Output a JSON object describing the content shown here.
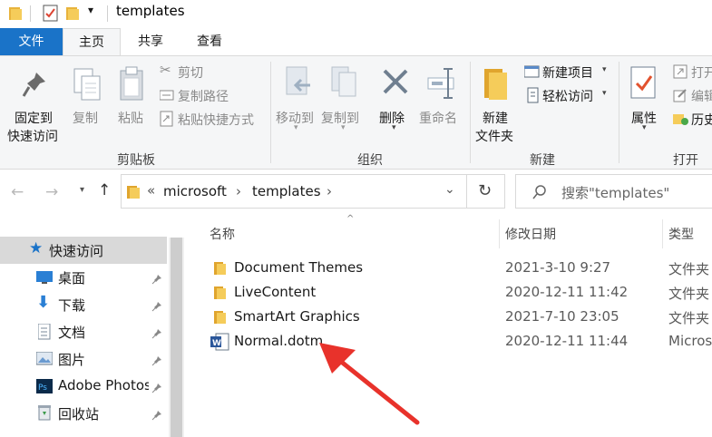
{
  "window": {
    "title": "templates"
  },
  "menu": {
    "file": "文件",
    "home": "主页",
    "share": "共享",
    "view": "查看"
  },
  "ribbon": {
    "pin_quick_access": [
      "固定到",
      "快速访问"
    ],
    "copy": "复制",
    "paste": "粘贴",
    "cut": "剪切",
    "copy_path": "复制路径",
    "paste_shortcut": "粘贴快捷方式",
    "move_to": "移动到",
    "copy_to": "复制到",
    "delete": "删除",
    "rename": "重命名",
    "new_folder": [
      "新建",
      "文件夹"
    ],
    "new_item": "新建项目",
    "easy_access": "轻松访问",
    "properties": "属性",
    "open": "打开",
    "edit": "编辑",
    "history": "历史",
    "groups": {
      "clipboard": "剪贴板",
      "organize": "组织",
      "new": "新建",
      "open": "打开"
    }
  },
  "address": {
    "overflow": "«",
    "crumbs": [
      "microsoft",
      "templates"
    ],
    "search_placeholder": "搜索\"templates\""
  },
  "sidebar": {
    "items": [
      {
        "label": "快速访问",
        "icon": "star-icon",
        "pinned": false
      },
      {
        "label": "桌面",
        "icon": "desktop-icon",
        "pinned": true
      },
      {
        "label": "下载",
        "icon": "download-icon",
        "pinned": true
      },
      {
        "label": "文档",
        "icon": "document-icon",
        "pinned": true
      },
      {
        "label": "图片",
        "icon": "pictures-icon",
        "pinned": true
      },
      {
        "label": "Adobe Photoshop",
        "icon": "photoshop-icon",
        "pinned": true
      },
      {
        "label": "回收站",
        "icon": "recycle-bin-icon",
        "pinned": true
      }
    ]
  },
  "columns": {
    "name": "名称",
    "date": "修改日期",
    "type": "类型"
  },
  "files": [
    {
      "name": "Document Themes",
      "date": "2021-3-10 9:27",
      "type": "文件夹",
      "kind": "folder"
    },
    {
      "name": "LiveContent",
      "date": "2020-12-11 11:42",
      "type": "文件夹",
      "kind": "folder"
    },
    {
      "name": "SmartArt Graphics",
      "date": "2021-7-10 23:05",
      "type": "文件夹",
      "kind": "folder"
    },
    {
      "name": "Normal.dotm",
      "date": "2020-12-11 11:44",
      "type": "Microsoft",
      "kind": "word-template"
    }
  ],
  "colors": {
    "accent": "#1a73c8",
    "folder": "#f2c14e",
    "arrow": "#e8322b"
  }
}
